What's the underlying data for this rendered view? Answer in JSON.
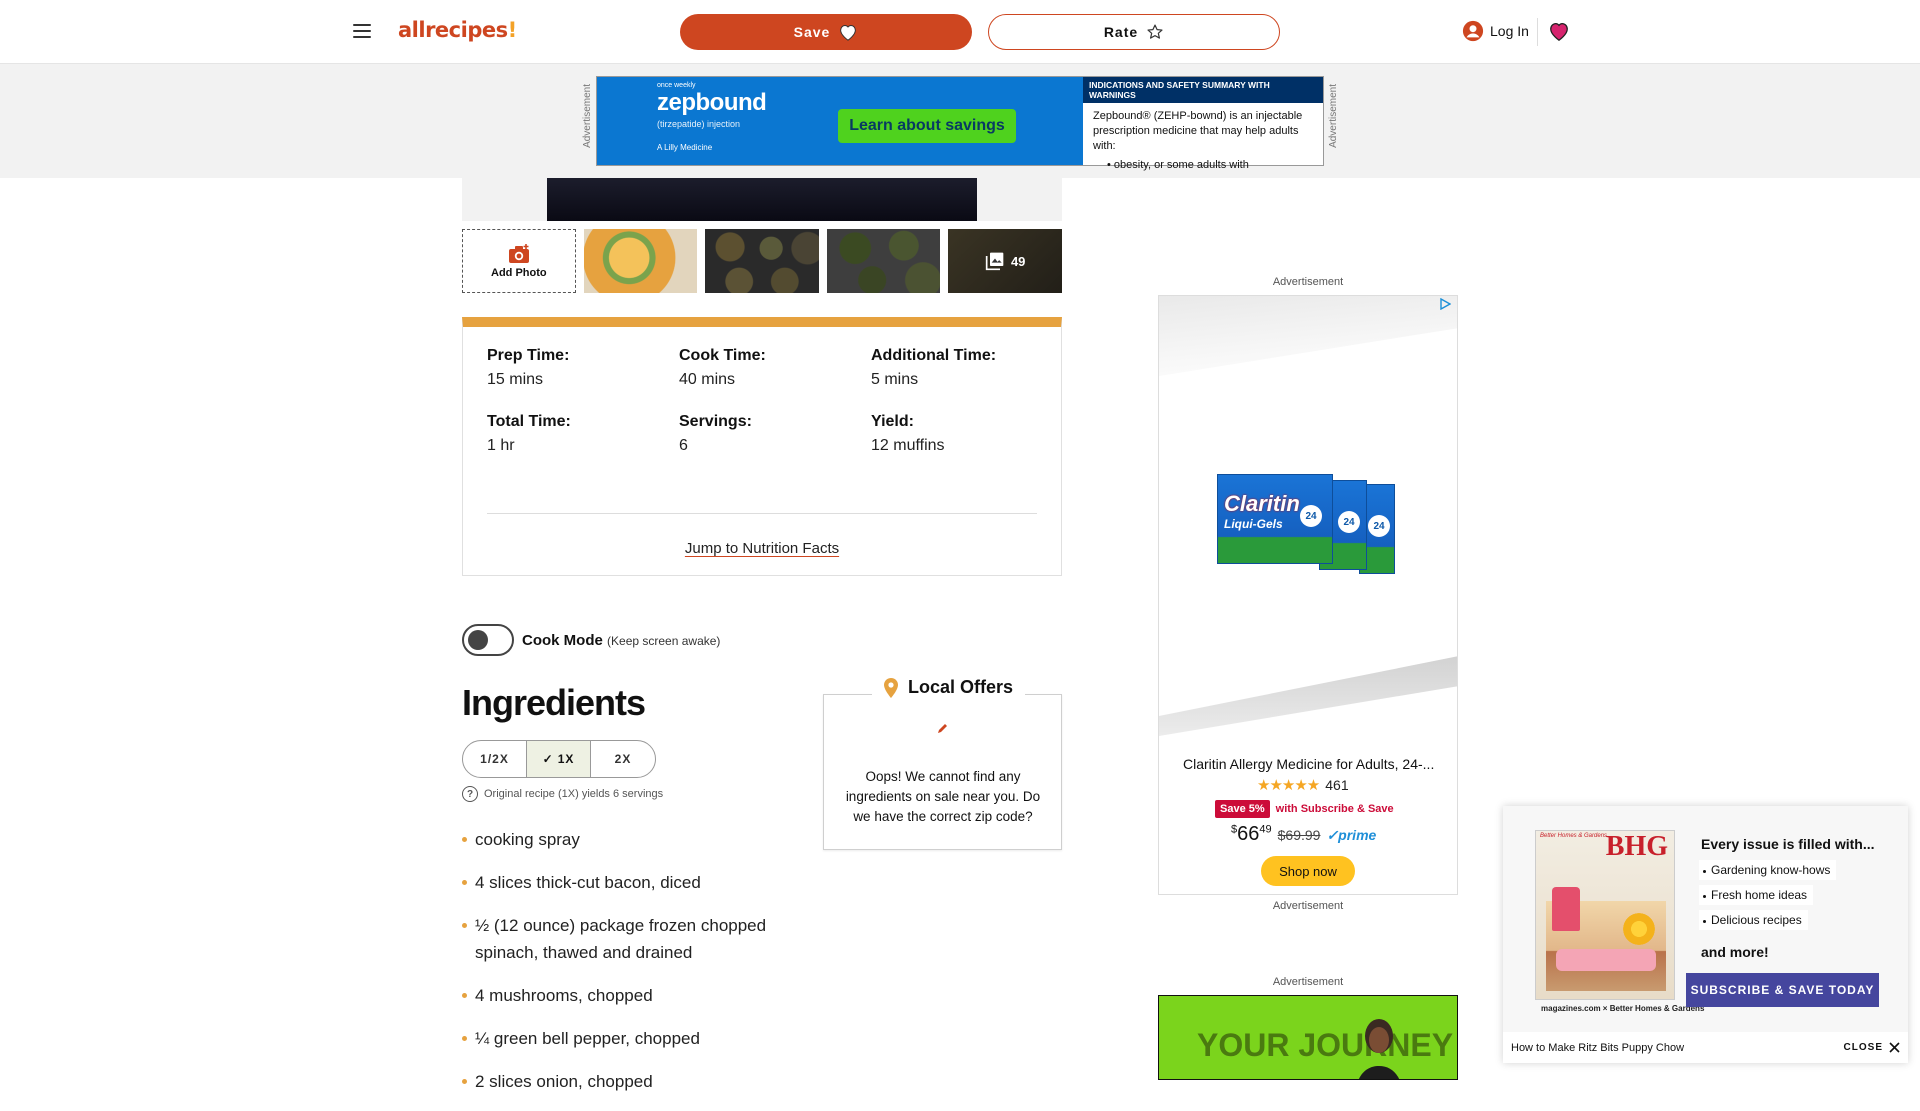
{
  "header": {
    "logo": "allrecipes",
    "save_label": "Save",
    "rate_label": "Rate",
    "login_label": "Log In",
    "colors": {
      "brand": "#ce4620",
      "accent": "#e6a23f"
    }
  },
  "top_ad": {
    "side_label": "Advertisement",
    "brand": "zepbound",
    "brand_prefix": "once weekly",
    "subtitle": "(tirzepatide) injection",
    "maker": "A Lilly Medicine",
    "cta": "Learn about savings",
    "right_header": "INDICATIONS AND SAFETY SUMMARY WITH WARNINGS",
    "right_text": "Zepbound® (ZEHP-bownd) is an injectable prescription medicine that may help adults with:",
    "right_bullet": "obesity, or some adults with"
  },
  "gallery": {
    "add_photo_label": "Add Photo",
    "photo_count": "49"
  },
  "details": {
    "items": [
      {
        "label": "Prep Time:",
        "value": "15 mins"
      },
      {
        "label": "Cook Time:",
        "value": "40 mins"
      },
      {
        "label": "Additional Time:",
        "value": "5 mins"
      },
      {
        "label": "Total Time:",
        "value": "1 hr"
      },
      {
        "label": "Servings:",
        "value": "6"
      },
      {
        "label": "Yield:",
        "value": "12 muffins"
      }
    ],
    "nutrition_link": "Jump to Nutrition Facts"
  },
  "cook_mode": {
    "label": "Cook Mode",
    "sub": "(Keep screen awake)"
  },
  "ingredients": {
    "title": "Ingredients",
    "scale_options": [
      "1/2X",
      "1X",
      "2X"
    ],
    "selected_scale": "1X",
    "yield_note": "Original recipe (1X) yields 6 servings",
    "items": [
      "cooking spray",
      "4 slices thick-cut bacon, diced",
      "½ (12 ounce) package frozen chopped spinach, thawed and drained",
      "4 mushrooms, chopped",
      "¼ green bell pepper, chopped",
      "2 slices onion, chopped"
    ]
  },
  "local_offers": {
    "title": "Local Offers",
    "message": "Oops! We cannot find any ingredients on sale near you. Do we have the correct zip code?"
  },
  "right_ads": {
    "label": "Advertisement",
    "claritin": {
      "box_brand": "Claritin",
      "box_sub": "Liqui-Gels",
      "box_badge": "24",
      "product_title": "Claritin Allergy Medicine for Adults, 24-...",
      "rating_count": "461",
      "save_badge": "Save 5%",
      "save_text": "with Subscribe & Save",
      "price_dollars": "66",
      "price_cents": "49",
      "was_price": "$69.99",
      "prime": "✓prime",
      "shop_label": "Shop now"
    },
    "journey_text": "YOUR JOURNEY"
  },
  "popup": {
    "heading": "Every issue is filled with...",
    "bullets": [
      "Gardening know-hows",
      "Fresh home ideas",
      "Delicious recipes"
    ],
    "more": "and more!",
    "cta": "SUBSCRIBE & SAVE TODAY",
    "mag_brand": "BHG",
    "mag_masthead": "Better Homes & Gardens",
    "mag_logos": "magazines.com × Better Homes & Gardens",
    "footer_link": "How to Make Ritz Bits Puppy Chow",
    "close_label": "CLOSE"
  }
}
